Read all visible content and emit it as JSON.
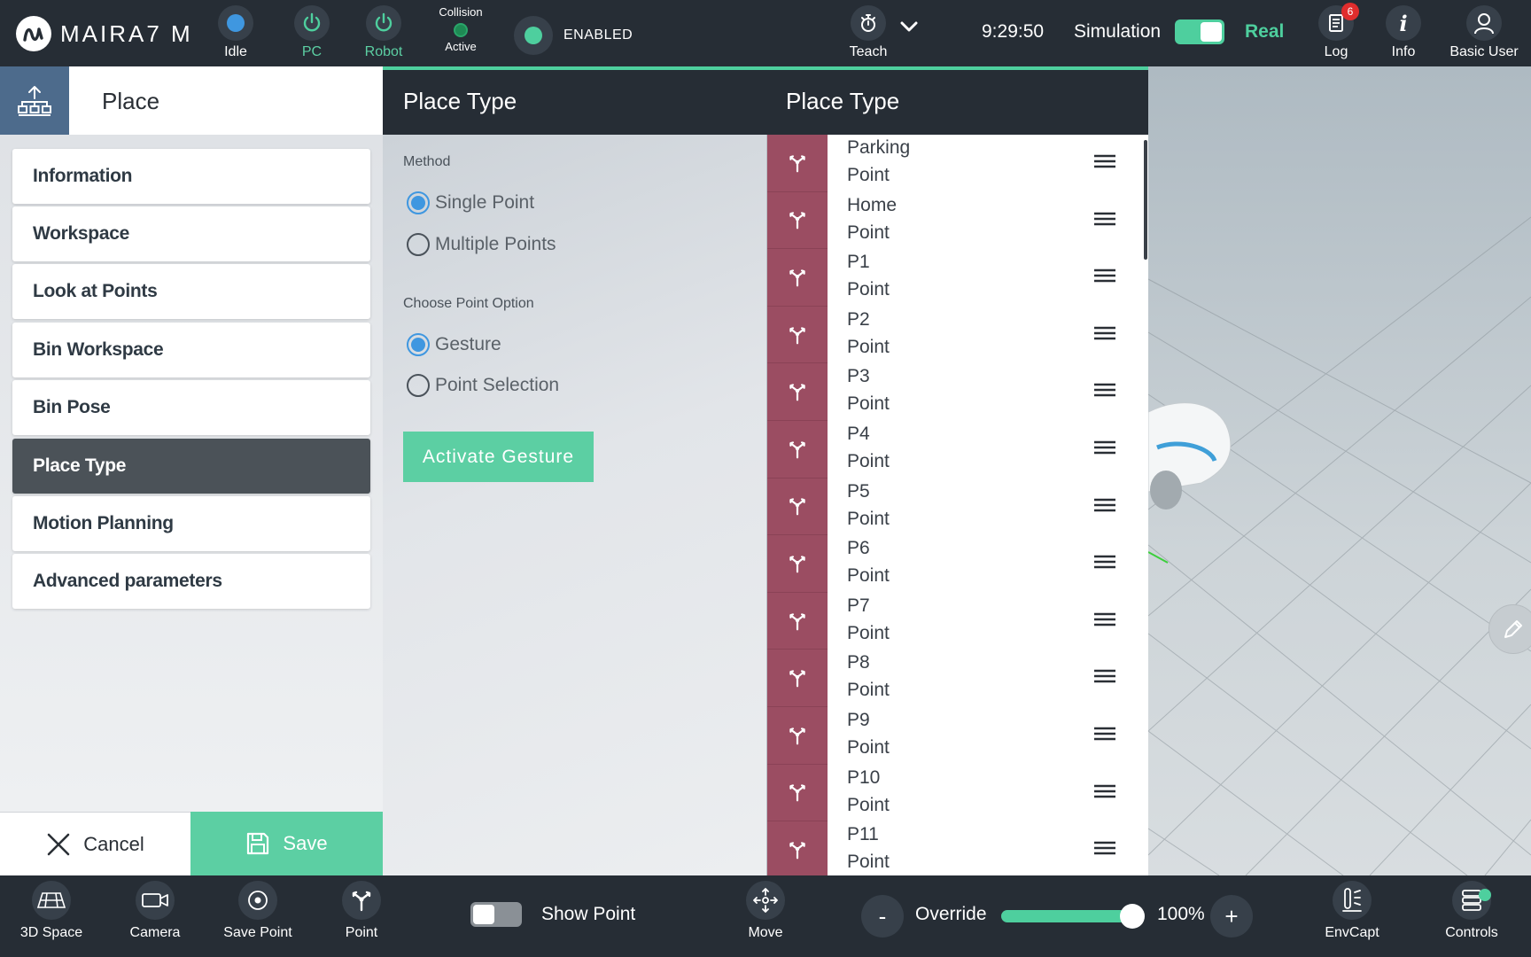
{
  "app": {
    "title": "MAIRA7 M"
  },
  "topbar": {
    "idle_label": "Idle",
    "pc_label": "PC",
    "robot_label": "Robot",
    "collision_label": "Collision",
    "collision_state": "Active",
    "enabled_label": "ENABLED",
    "teach_label": "Teach",
    "time": "9:29:50",
    "simulation_label": "Simulation",
    "real_label": "Real",
    "log_label": "Log",
    "log_badge": "6",
    "info_label": "Info",
    "user_label": "Basic User"
  },
  "left_panel": {
    "title": "Place",
    "menu": [
      {
        "label": "Information"
      },
      {
        "label": "Workspace"
      },
      {
        "label": "Look at Points"
      },
      {
        "label": "Bin Workspace"
      },
      {
        "label": "Bin Pose"
      },
      {
        "label": "Place Type",
        "active": true
      },
      {
        "label": "Motion Planning"
      },
      {
        "label": "Advanced parameters"
      }
    ],
    "cancel_label": "Cancel",
    "save_label": "Save"
  },
  "middle_panel": {
    "title_left": "Place Type",
    "title_right": "Place Type",
    "method_label": "Method",
    "method_options": [
      "Single Point",
      "Multiple Points"
    ],
    "method_selected": "Single Point",
    "choose_label": "Choose Point Option",
    "choose_options": [
      "Gesture",
      "Point Selection"
    ],
    "choose_selected": "Gesture",
    "activate_label": "Activate Gesture"
  },
  "point_list": [
    {
      "name": "Parking",
      "type": "Point"
    },
    {
      "name": "Home",
      "type": "Point"
    },
    {
      "name": "P1",
      "type": "Point"
    },
    {
      "name": "P2",
      "type": "Point"
    },
    {
      "name": "P3",
      "type": "Point"
    },
    {
      "name": "P4",
      "type": "Point"
    },
    {
      "name": "P5",
      "type": "Point"
    },
    {
      "name": "P6",
      "type": "Point"
    },
    {
      "name": "P7",
      "type": "Point"
    },
    {
      "name": "P8",
      "type": "Point"
    },
    {
      "name": "P9",
      "type": "Point"
    },
    {
      "name": "P10",
      "type": "Point"
    },
    {
      "name": "P11",
      "type": "Point"
    }
  ],
  "bottombar": {
    "space_label": "3D Space",
    "camera_label": "Camera",
    "save_point_label": "Save Point",
    "point_label": "Point",
    "show_point_label": "Show Point",
    "move_label": "Move",
    "override_label": "Override",
    "override_value": 100,
    "override_pct": "100%",
    "minus": "-",
    "plus": "+",
    "envcapt_label": "EnvCapt",
    "controls_label": "Controls"
  },
  "colors": {
    "accent": "#4ecf9e",
    "topbar": "#262d35",
    "point_strip": "#9b4d62",
    "radio_on": "#3f97e0"
  },
  "icons": {
    "logo": "maira-logo-icon",
    "idle": "status-dot-icon",
    "pc": "power-icon",
    "robot": "power-icon",
    "teach": "stopwatch-icon",
    "log": "log-document-icon",
    "info": "info-icon",
    "user": "user-icon",
    "place": "hierarchy-icon",
    "point": "gripper-icon",
    "handle": "drag-handle-icon",
    "edit": "pencil-icon"
  }
}
